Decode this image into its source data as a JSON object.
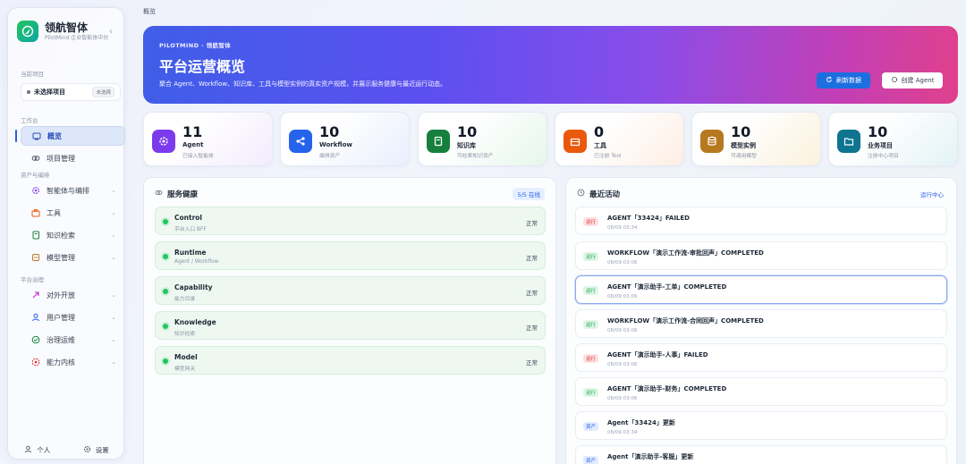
{
  "brand": {
    "name": "领航智体",
    "subtitle": "PilotMind 企业智能体中台"
  },
  "sidebar": {
    "project_label": "当前项目",
    "project_name": "未选择项目",
    "project_button": "未选择",
    "section_workspace": "工作台",
    "section_assets": "资产与编排",
    "section_governance": "平台治理",
    "items": [
      {
        "label": "概览"
      },
      {
        "label": "项目管理"
      },
      {
        "label": "智能体与编排"
      },
      {
        "label": "工具"
      },
      {
        "label": "知识检索"
      },
      {
        "label": "模型管理"
      },
      {
        "label": "对外开放"
      },
      {
        "label": "用户管理"
      },
      {
        "label": "治理运维"
      },
      {
        "label": "能力内核"
      }
    ],
    "footer_personal": "个人",
    "footer_settings": "设置"
  },
  "breadcrumb": "概览",
  "hero": {
    "eyebrow": "PILOTMIND · 领航智体",
    "title": "平台运营概览",
    "desc": "聚合 Agent、Workflow、知识库、工具与模型实例的真实资产规模，并展示服务健康与最近运行动态。",
    "refresh": "刷新数据",
    "create": "创建 Agent"
  },
  "stats": [
    {
      "num": "11",
      "label": "Agent",
      "sub": "已接入智能体",
      "color": "#7c3aed"
    },
    {
      "num": "10",
      "label": "Workflow",
      "sub": "编排资产",
      "color": "#2563eb"
    },
    {
      "num": "10",
      "label": "知识库",
      "sub": "可检索知识资产",
      "color": "#15803d"
    },
    {
      "num": "0",
      "label": "工具",
      "sub": "已注册 Tool",
      "color": "#ea580c"
    },
    {
      "num": "10",
      "label": "模型实例",
      "sub": "可调用模型",
      "color": "#b7791f"
    },
    {
      "num": "10",
      "label": "业务项目",
      "sub": "注册中心项目",
      "color": "#0e7490"
    }
  ],
  "health": {
    "title": "服务健康",
    "badge": "5/5 在线",
    "rows": [
      {
        "name": "Control",
        "sub": "平台入口 BFF",
        "status": "正常"
      },
      {
        "name": "Runtime",
        "sub": "Agent / Workflow",
        "status": "正常"
      },
      {
        "name": "Capability",
        "sub": "能力目录",
        "status": "正常"
      },
      {
        "name": "Knowledge",
        "sub": "知识检索",
        "status": "正常"
      },
      {
        "name": "Model",
        "sub": "模型网关",
        "status": "正常"
      }
    ]
  },
  "activity": {
    "title": "最近活动",
    "link": "运行中心",
    "rows": [
      {
        "tag": "运行",
        "tag_type": "fail",
        "title": "AGENT「33424」FAILED",
        "time": "08/09 03:34"
      },
      {
        "tag": "运行",
        "tag_type": "run",
        "title": "WORKFLOW「演示工作流-审批回声」COMPLETED",
        "time": "08/09 03:06"
      },
      {
        "tag": "运行",
        "tag_type": "run",
        "title": "AGENT「演示助手-工单」COMPLETED",
        "time": "08/09 03:06"
      },
      {
        "tag": "运行",
        "tag_type": "run",
        "title": "WORKFLOW「演示工作流-合同回声」COMPLETED",
        "time": "08/09 03:06"
      },
      {
        "tag": "运行",
        "tag_type": "fail",
        "title": "AGENT「演示助手-人事」FAILED",
        "time": "08/09 03:06"
      },
      {
        "tag": "运行",
        "tag_type": "run",
        "title": "AGENT「演示助手-财务」COMPLETED",
        "time": "08/09 03:06"
      },
      {
        "tag": "资产",
        "tag_type": "asset",
        "title": "Agent「33424」更新",
        "time": "08/09 03:34"
      },
      {
        "tag": "资产",
        "tag_type": "asset",
        "title": "Agent「演示助手-客服」更新",
        "time": ""
      }
    ]
  }
}
